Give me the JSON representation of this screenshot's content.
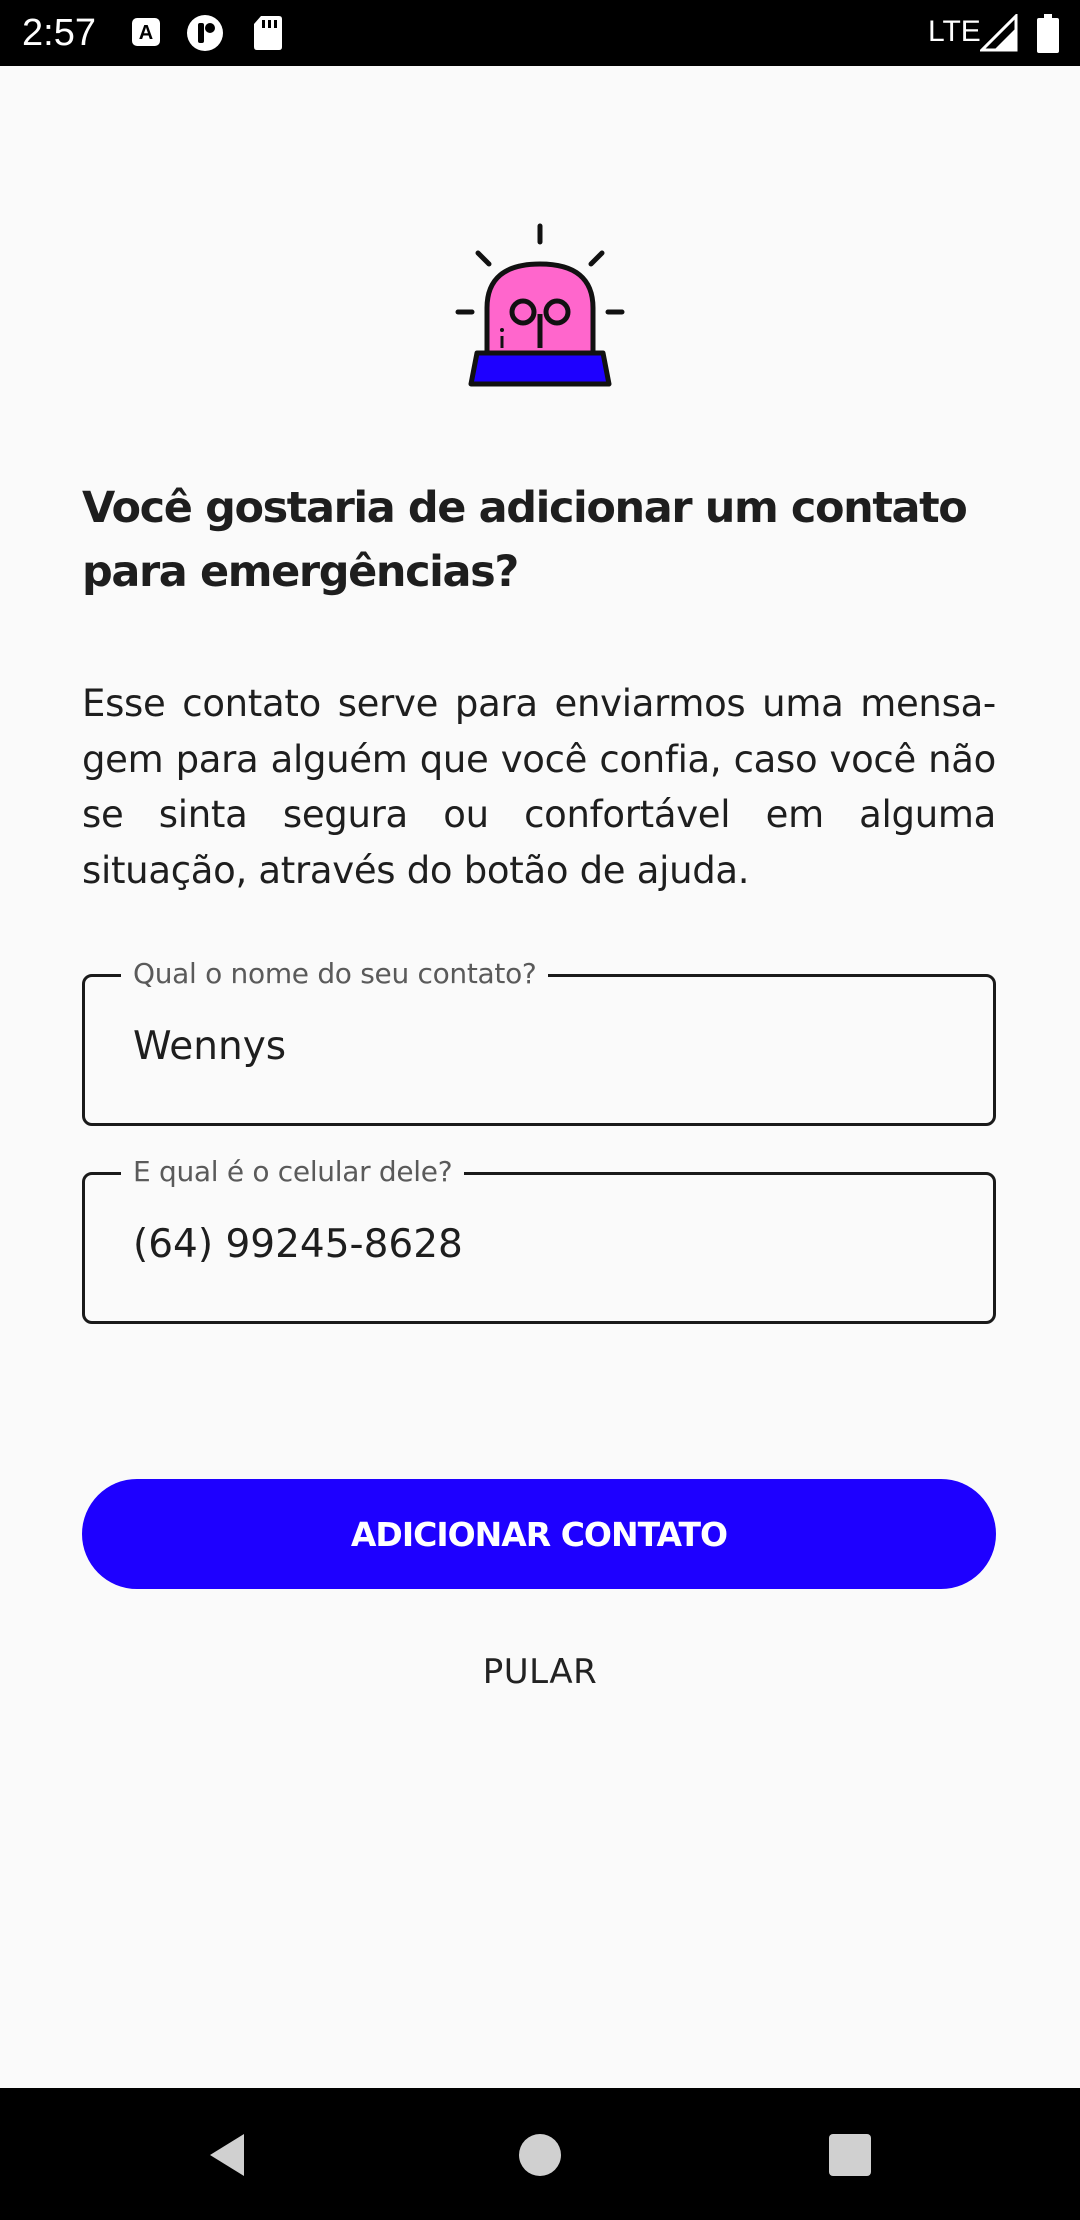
{
  "status_bar": {
    "time": "2:57",
    "network": "LTE",
    "icons": [
      "a-box-icon",
      "tap-circle-icon",
      "sd-card-icon",
      "signal-icon",
      "battery-icon"
    ]
  },
  "onboarding": {
    "illustration": "siren-alarm-icon",
    "title": "Você gostaria de adicionar um contato para emergências?",
    "description": "Esse contato serve para enviarmos uma mensa-gem para alguém que você confia, caso você não se sinta segura ou confortável em alguma situação, através do botão de ajuda."
  },
  "form": {
    "name_label": "Qual o nome do seu contato?",
    "name_value": "Wennys",
    "phone_label": "E qual é o celular dele?",
    "phone_value": "(64) 99245-8628"
  },
  "actions": {
    "add_label": "ADICIONAR CONTATO",
    "skip_label": "PULAR"
  },
  "colors": {
    "accent": "#1E00FF",
    "background": "#FAFAFA",
    "siren_dome": "#FF66CC",
    "siren_base": "#1E00FF"
  },
  "nav_bar": {
    "icons": [
      "back-icon",
      "home-icon",
      "recents-icon"
    ]
  }
}
